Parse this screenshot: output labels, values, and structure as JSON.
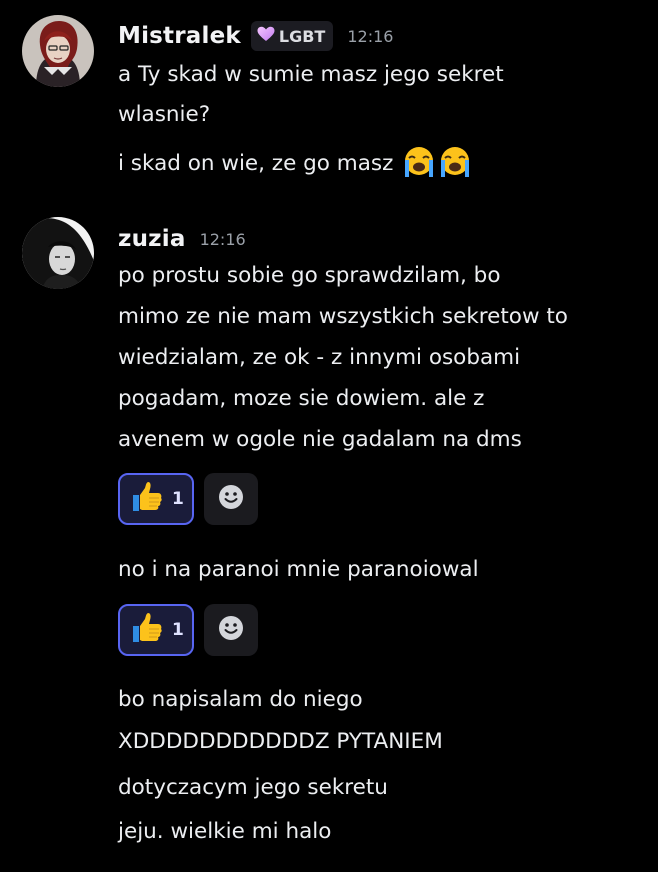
{
  "messages": [
    {
      "author": "Mistralek",
      "tag": "LGBT",
      "time": "12:16",
      "lines": [
        "a Ty skad w sumie masz jego sekret",
        "wlasnie?",
        "i skad on wie, ze go masz"
      ],
      "emoji_icons": [
        "loudly-crying-face-icon",
        "loudly-crying-face-icon"
      ]
    },
    {
      "author": "zuzia",
      "time": "12:16",
      "lines": [
        "po prostu sobie go sprawdzilam, bo",
        "mimo ze nie mam wszystkich sekretow to",
        "wiedzialam, ze ok - z innymi osobami",
        "pogadam, moze sie dowiem. ale z",
        "avenem w ogole nie gadalam na dms"
      ],
      "reaction": {
        "icon": "thumbs-up-icon",
        "count": "1"
      },
      "followups": [
        {
          "lines": [
            "no i na paranoi mnie paranoiowal"
          ],
          "reaction": {
            "icon": "thumbs-up-icon",
            "count": "1"
          }
        },
        {
          "lines": [
            "bo napisalam do niego",
            "XDDDDDDDDDDDZ PYTANIEM",
            "dotyczacym jego sekretu",
            "jeju. wielkie mi halo"
          ]
        }
      ]
    }
  ],
  "colors": {
    "background": "#000000",
    "reaction_border": "#5865f2",
    "reaction_bg": "#1a1c3a",
    "timestamp": "#9aa0a8"
  }
}
